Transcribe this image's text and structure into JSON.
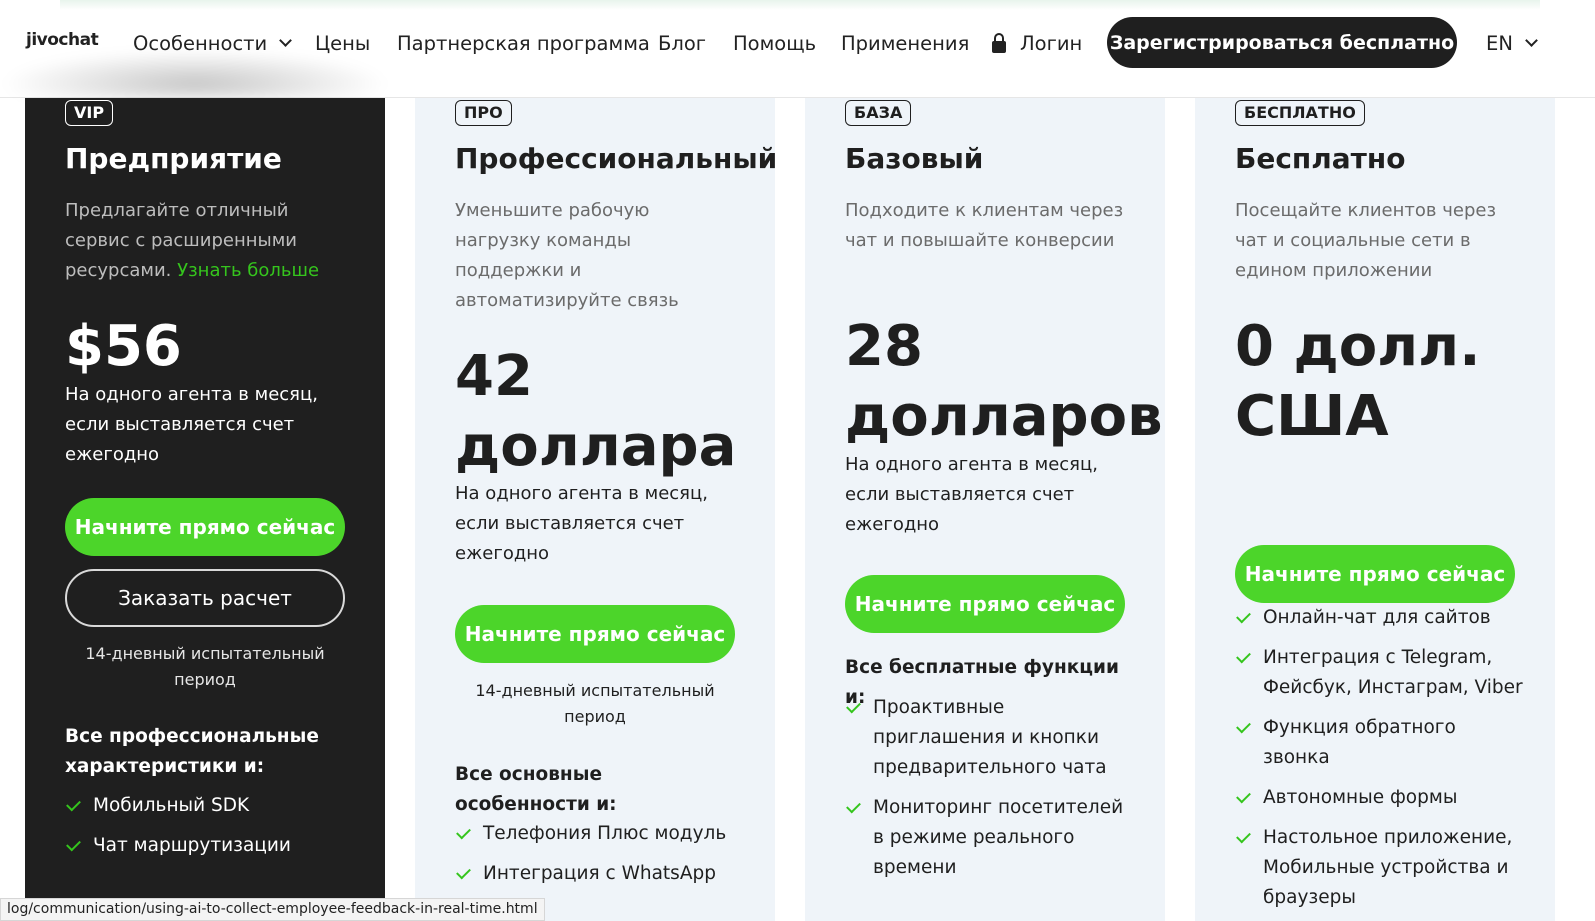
{
  "header": {
    "logo": "jivochat",
    "nav": [
      {
        "label": "Особенности"
      },
      {
        "label": "Цены"
      },
      {
        "label": "Партнерская программа"
      },
      {
        "label": "Блог"
      },
      {
        "label": "Помощь"
      },
      {
        "label": "Применения"
      },
      {
        "label": "Логин"
      }
    ],
    "signup_label": "Зарегистрироваться бесплатно",
    "language": "EN"
  },
  "plans": [
    {
      "badge": "VIP",
      "title": "Предприятие",
      "description": "Предлагайте отличный сервис с расширенными ресурсами.",
      "learn_more": "Узнать больше",
      "price": "$56",
      "price_note": "На одного агента в месяц, если выставляется счет ежегодно",
      "start_label": "Начните прямо сейчас",
      "quote_label": "Заказать расчет",
      "trial": "14-дневный испытательный период",
      "features_heading": "Все профессиональные характеристики и:",
      "features": [
        "Мобильный SDK",
        "Чат маршрутизации"
      ]
    },
    {
      "badge": "ПРО",
      "title": "Профессиональный",
      "description": "Уменьшите рабочую нагрузку команды поддержки и автоматизируйте связь",
      "price": "42 доллара",
      "price_note": "На одного агента в месяц, если выставляется счет ежегодно",
      "start_label": "Начните прямо сейчас",
      "trial": "14-дневный испытательный период",
      "features_heading": "Все основные особенности и:",
      "features": [
        "Телефония Плюс модуль",
        "Интеграция с WhatsApp"
      ]
    },
    {
      "badge": "БАЗА",
      "title": "Базовый",
      "description": "Подходите к клиентам через чат и повышайте конверсии",
      "price": "28 долларов",
      "price_note": "На одного агента в месяц, если выставляется счет ежегодно",
      "start_label": "Начните прямо сейчас",
      "features_heading": "Все бесплатные функции и:",
      "features": [
        "Проактивные приглашения и кнопки предварительного чата",
        "Мониторинг посетителей в режиме реального времени"
      ]
    },
    {
      "badge": "БЕСПЛАТНО",
      "title": "Бесплатно",
      "description": "Посещайте клиентов через чат и социальные сети в едином приложении",
      "price": "0 долл. США",
      "start_label": "Начните прямо сейчас",
      "features": [
        "Онлайн-чат для сайтов",
        "Интеграция с Telegram, Фейсбук, Инстаграм, Viber",
        "Функция обратного звонка",
        "Автономные формы",
        "Настольное приложение, Мобильные устройства и браузеры"
      ]
    }
  ],
  "status_url": "log/communication/using-ai-to-collect-employee-feedback-in-real-time.html",
  "colors": {
    "accent_green": "#4cd52a",
    "dark": "#1f1f1f",
    "card_light": "#eff4f9"
  }
}
